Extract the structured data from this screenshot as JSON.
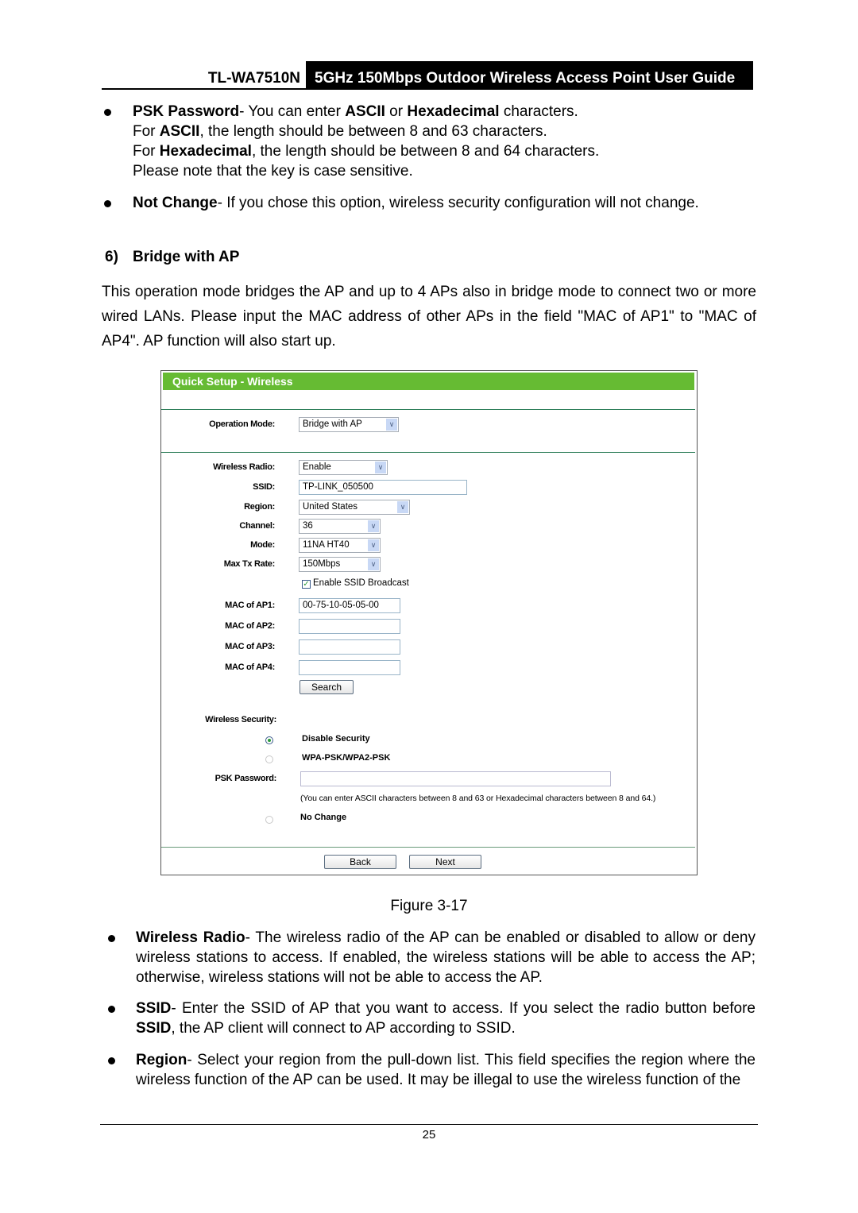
{
  "header": {
    "model": "TL-WA7510N",
    "title": "5GHz 150Mbps Outdoor Wireless Access Point User Guide"
  },
  "top_bullets": [
    {
      "lines": [
        [
          {
            "b": true,
            "t": "PSK Password"
          },
          {
            "t": "- You can enter "
          },
          {
            "b": true,
            "t": "ASCII"
          },
          {
            "t": " or "
          },
          {
            "b": true,
            "t": "Hexadecimal"
          },
          {
            "t": " characters."
          }
        ],
        [
          {
            "t": "For "
          },
          {
            "b": true,
            "t": "ASCII"
          },
          {
            "t": ", the length should be between 8 and 63 characters."
          }
        ],
        [
          {
            "t": "For "
          },
          {
            "b": true,
            "t": "Hexadecimal"
          },
          {
            "t": ", the length should be between 8 and 64 characters."
          }
        ],
        [
          {
            "t": "Please note that the key is case sensitive."
          }
        ]
      ]
    },
    {
      "lines": [
        [
          {
            "b": true,
            "t": "Not Change"
          },
          {
            "t": "- If you chose this option, wireless security configuration will not change."
          }
        ]
      ]
    }
  ],
  "section": {
    "number": "6)",
    "title": "Bridge with AP"
  },
  "intro_lines": [
    "This operation mode bridges the AP and up to 4 APs also in bridge mode to connect two or more",
    "wired LANs. Please input the MAC address of other APs in the field \"MAC of AP1\" to \"MAC of",
    "AP4\". AP function will also start up."
  ],
  "figure": {
    "title": "Quick Setup - Wireless",
    "operation_mode": {
      "label": "Operation Mode:",
      "value": "Bridge with AP"
    },
    "wireless_radio": {
      "label": "Wireless Radio:",
      "value": "Enable"
    },
    "ssid": {
      "label": "SSID:",
      "value": "TP-LINK_050500"
    },
    "region": {
      "label": "Region:",
      "value": "United States"
    },
    "channel": {
      "label": "Channel:",
      "value": "36"
    },
    "mode": {
      "label": "Mode:",
      "value": "11NA HT40"
    },
    "max_tx_rate": {
      "label": "Max Tx Rate:",
      "value": "150Mbps"
    },
    "ssid_broadcast": {
      "label": "Enable SSID Broadcast",
      "checked": true
    },
    "mac": [
      {
        "label": "MAC of AP1:",
        "value": "00-75-10-05-05-00"
      },
      {
        "label": "MAC of AP2:",
        "value": ""
      },
      {
        "label": "MAC of AP3:",
        "value": ""
      },
      {
        "label": "MAC of AP4:",
        "value": ""
      }
    ],
    "search_label": "Search",
    "security_label": "Wireless Security:",
    "disable_security": {
      "label": "Disable Security",
      "selected": true
    },
    "wpa": {
      "label": "WPA-PSK/WPA2-PSK",
      "selected": false
    },
    "psk": {
      "label": "PSK Password:",
      "value": ""
    },
    "psk_note": "(You can enter ASCII characters between 8 and 63 or Hexadecimal characters between 8 and 64.)",
    "no_change": {
      "label": "No Change",
      "selected": false
    },
    "back_label": "Back",
    "next_label": "Next",
    "accent": "#66bb33"
  },
  "caption": "Figure 3-17",
  "bottom_bullets": [
    {
      "lines": [
        [
          {
            "b": true,
            "t": "Wireless Radio"
          },
          {
            "t": "- The wireless radio of the AP can be enabled or disabled to allow or deny"
          }
        ],
        [
          {
            "t": "wireless stations to access. If enabled, the wireless stations will be able to access the AP;"
          }
        ],
        [
          {
            "t": "otherwise, wireless stations will not be able to access the AP."
          }
        ]
      ]
    },
    {
      "lines": [
        [
          {
            "b": true,
            "t": "SSID"
          },
          {
            "t": "- Enter the SSID of AP that you want to access. If you select the radio button before"
          }
        ],
        [
          {
            "b": true,
            "t": "SSID"
          },
          {
            "t": ", the AP client will connect to AP according to SSID."
          }
        ]
      ]
    },
    {
      "lines": [
        [
          {
            "b": true,
            "t": "Region"
          },
          {
            "t": "- Select your region from the pull-down list. This field specifies the region where the"
          }
        ],
        [
          {
            "t": "wireless function of the AP can be used. It may be illegal to use the wireless function of the"
          }
        ]
      ]
    }
  ],
  "page_number": "25"
}
